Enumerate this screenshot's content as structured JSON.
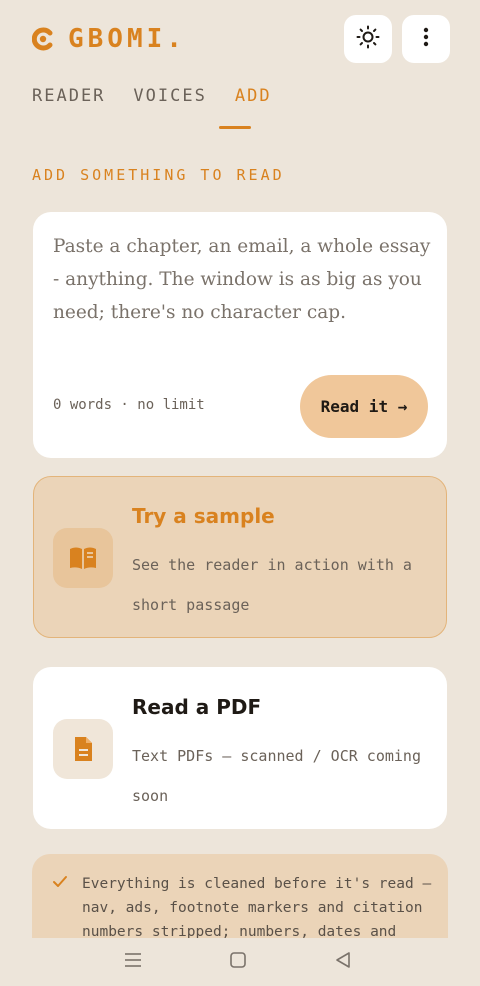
{
  "brand": {
    "name": "GBOMI."
  },
  "header": {
    "theme_icon": "sun-icon",
    "menu_icon": "more-vertical-icon"
  },
  "tabs": [
    {
      "label": "READER",
      "active": false
    },
    {
      "label": "VOICES",
      "active": false
    },
    {
      "label": "ADD",
      "active": true
    }
  ],
  "section_title": "ADD SOMETHING TO READ",
  "paste": {
    "placeholder": "Paste a chapter, an email, a whole essay - anything. The window is as big as you need; there's no character cap.",
    "word_count": "0 words · no limit",
    "read_button": "Read it →"
  },
  "sample": {
    "title": "Try a sample",
    "description": "See the reader in action with a short passage",
    "icon": "book-open-icon"
  },
  "pdf": {
    "title": "Read a PDF",
    "description": "Text PDFs — scanned / OCR coming soon",
    "icon": "document-icon"
  },
  "info": {
    "text": "Everything is cleaned before it's read — nav, ads, footnote markers and citation numbers stripped; numbers, dates and"
  },
  "colors": {
    "accent": "#d9821f",
    "background": "#ede5da",
    "button": "#f0c79a",
    "sample_bg": "#ebd4b8"
  }
}
